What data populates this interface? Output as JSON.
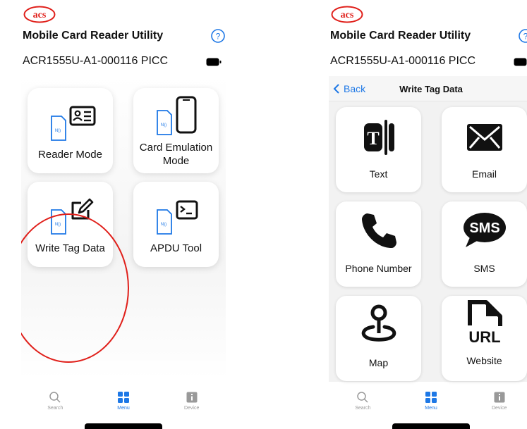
{
  "header": {
    "logo_text": "acs",
    "app_title": "Mobile Card Reader Utility",
    "device_name": "ACR1555U-A1-000116 PICC"
  },
  "menu": {
    "tiles": [
      {
        "label": "Reader Mode"
      },
      {
        "label": "Card Emulation Mode"
      },
      {
        "label": "Write Tag Data"
      },
      {
        "label": "APDU Tool"
      }
    ]
  },
  "write_tag": {
    "back_label": "Back",
    "title": "Write Tag Data",
    "tiles": [
      {
        "label": "Text"
      },
      {
        "label": "Email"
      },
      {
        "label": "Phone Number"
      },
      {
        "label": "SMS"
      },
      {
        "label": "Map"
      },
      {
        "label": "Website"
      }
    ],
    "sms_icon_text": "SMS",
    "url_icon_text": "URL",
    "text_icon_letter": "T"
  },
  "tabbar": {
    "tabs": [
      {
        "label": "Search"
      },
      {
        "label": "Menu"
      },
      {
        "label": "Device"
      }
    ],
    "active": "Menu"
  },
  "colors": {
    "accent": "#1e78e6",
    "brand_red": "#e0201b",
    "icon_dark": "#111111",
    "inactive_tab": "#999999"
  }
}
